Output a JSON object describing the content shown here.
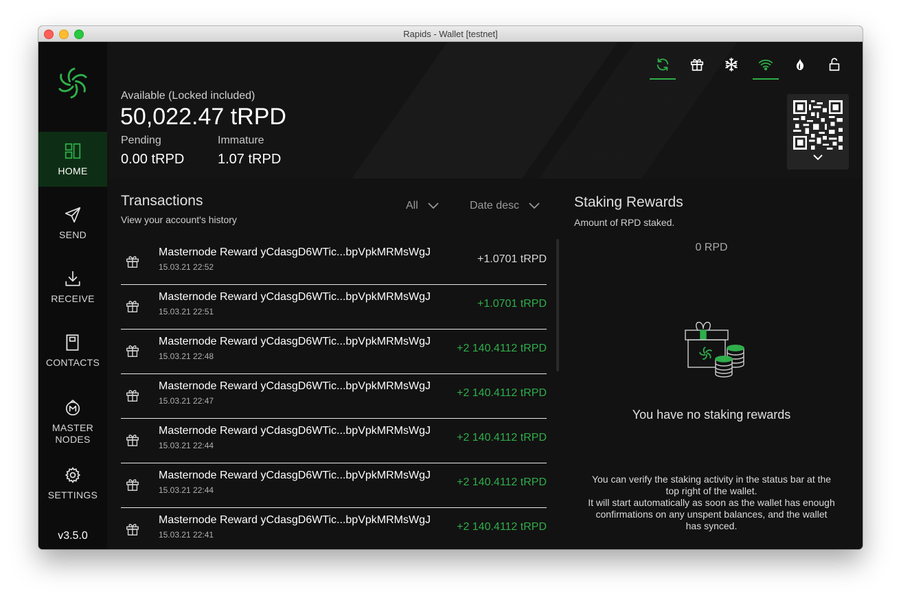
{
  "window": {
    "title": "Rapids - Wallet [testnet]"
  },
  "sidebar": {
    "items": [
      {
        "label": "HOME",
        "icon": "home-dashboard-icon",
        "active": true
      },
      {
        "label": "SEND",
        "icon": "send-paper-plane-icon",
        "active": false
      },
      {
        "label": "RECEIVE",
        "icon": "download-icon",
        "active": false
      },
      {
        "label": "CONTACTS",
        "icon": "contacts-book-icon",
        "active": false
      },
      {
        "label": "MASTER NODES",
        "icon": "masternode-icon",
        "active": false
      },
      {
        "label": "SETTINGS",
        "icon": "gear-icon",
        "active": false
      }
    ],
    "version": "v3.5.0"
  },
  "header": {
    "available_label": "Available (Locked included)",
    "available_value": "50,022.47 tRPD",
    "pending_label": "Pending",
    "pending_value": "0.00 tRPD",
    "immature_label": "Immature",
    "immature_value": "1.07 tRPD",
    "status_icons": [
      "sync-icon",
      "gift-icon",
      "snowflake-icon",
      "wifi-icon",
      "tor-onion-icon",
      "unlock-icon"
    ]
  },
  "transactions": {
    "title": "Transactions",
    "subtitle": "View your account's history",
    "filter_type": "All",
    "filter_sort": "Date desc",
    "rows": [
      {
        "name": "Masternode Reward yCdasgD6WTic...bpVpkMRMsWgJ",
        "date": "15.03.21 22:52",
        "amount": "+1.0701 tRPD",
        "color": "#d6d6d6"
      },
      {
        "name": "Masternode Reward yCdasgD6WTic...bpVpkMRMsWgJ",
        "date": "15.03.21 22:51",
        "amount": "+1.0701 tRPD",
        "color": "#2fae4a"
      },
      {
        "name": "Masternode Reward yCdasgD6WTic...bpVpkMRMsWgJ",
        "date": "15.03.21 22:48",
        "amount": "+2 140.4112 tRPD",
        "color": "#2fae4a"
      },
      {
        "name": "Masternode Reward yCdasgD6WTic...bpVpkMRMsWgJ",
        "date": "15.03.21 22:47",
        "amount": "+2 140.4112 tRPD",
        "color": "#2fae4a"
      },
      {
        "name": "Masternode Reward yCdasgD6WTic...bpVpkMRMsWgJ",
        "date": "15.03.21 22:44",
        "amount": "+2 140.4112 tRPD",
        "color": "#2fae4a"
      },
      {
        "name": "Masternode Reward yCdasgD6WTic...bpVpkMRMsWgJ",
        "date": "15.03.21 22:44",
        "amount": "+2 140.4112 tRPD",
        "color": "#2fae4a"
      },
      {
        "name": "Masternode Reward yCdasgD6WTic...bpVpkMRMsWgJ",
        "date": "15.03.21 22:41",
        "amount": "+2 140.4112 tRPD",
        "color": "#2fae4a"
      }
    ]
  },
  "staking": {
    "title": "Staking Rewards",
    "subtitle": "Amount of RPD staked.",
    "amount": "0 RPD",
    "empty_message": "You have no staking rewards",
    "info_lines": [
      "You can verify the staking activity in the status bar at the top right of the wallet.",
      "It will start automatically as soon as the wallet has enough confirmations on any unspent balances, and the wallet has synced."
    ]
  },
  "colors": {
    "accent": "#2fae4a",
    "background": "#121212",
    "sidebar": "#0c0c0c",
    "active_nav": "#0d2e14"
  }
}
